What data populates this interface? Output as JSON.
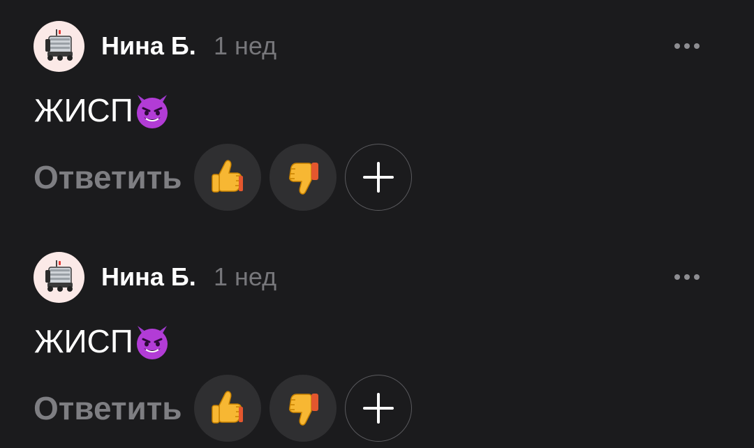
{
  "comments": [
    {
      "author": "Нина Б.",
      "time": "1 нед",
      "text": "ЖИСП",
      "text_emoji": "smiling-devil",
      "reply_label": "Ответить",
      "reactions": [
        "thumbs-up",
        "thumbs-down"
      ]
    },
    {
      "author": "Нина Б.",
      "time": "1 нед",
      "text": "ЖИСП",
      "text_emoji": "smiling-devil",
      "reply_label": "Ответить",
      "reactions": [
        "thumbs-up",
        "thumbs-down"
      ]
    }
  ],
  "icons": {
    "avatar": "delivery-robot-icon",
    "more": "more-dots-icon",
    "add_reaction": "plus-icon"
  },
  "colors": {
    "background": "#1b1b1d",
    "author": "#ffffff",
    "time": "#77777b",
    "reply": "#7e7e82",
    "reaction_bg": "#2f2f31",
    "emoji_devil": "#b23cd6"
  }
}
